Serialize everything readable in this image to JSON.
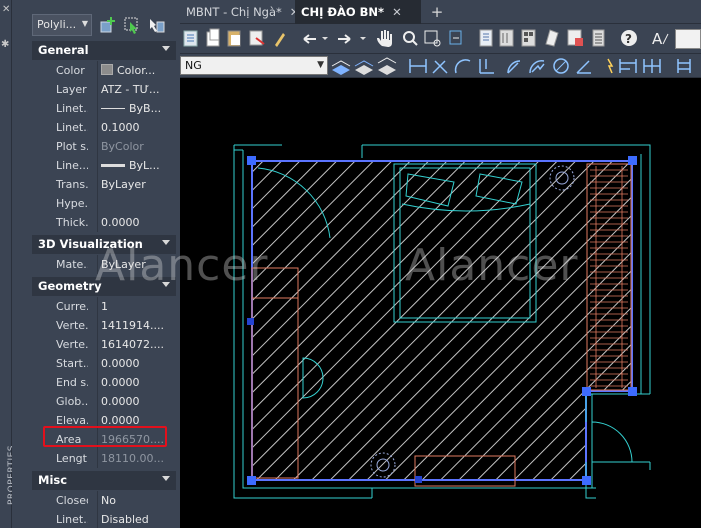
{
  "palette": {
    "object_type": "Polyli...",
    "vertical_title": "PROPERTIES",
    "sections": {
      "general": "General",
      "viz3d": "3D Visualization",
      "geometry": "Geometry",
      "misc": "Misc"
    },
    "general_rows": [
      {
        "label": "Color",
        "value": "Color..."
      },
      {
        "label": "Layer",
        "value": "ATZ - TƯ..."
      },
      {
        "label": "Linet...",
        "value": "ByB..."
      },
      {
        "label": "Linet...",
        "value": "0.1000"
      },
      {
        "label": "Plot s...",
        "value": "ByColor"
      },
      {
        "label": "Line...",
        "value": "ByL..."
      },
      {
        "label": "Trans...",
        "value": "ByLayer"
      },
      {
        "label": "Hype...",
        "value": ""
      },
      {
        "label": "Thick...",
        "value": "0.0000"
      }
    ],
    "viz3d_rows": [
      {
        "label": "Mate...",
        "value": "ByLayer"
      }
    ],
    "geometry_rows": [
      {
        "label": "Curre...",
        "value": "1"
      },
      {
        "label": "Verte...",
        "value": "1411914...."
      },
      {
        "label": "Verte...",
        "value": "1614072...."
      },
      {
        "label": "Start...",
        "value": "0.0000"
      },
      {
        "label": "End s...",
        "value": "0.0000"
      },
      {
        "label": "Glob...",
        "value": "0.0000"
      },
      {
        "label": "Eleva...",
        "value": "0.0000"
      },
      {
        "label": "Area",
        "value": "1966570...."
      },
      {
        "label": "Length",
        "value": "18110.00..."
      }
    ],
    "misc_rows": [
      {
        "label": "Closed",
        "value": "No"
      },
      {
        "label": "Linet...",
        "value": "Disabled"
      }
    ]
  },
  "tabs": [
    {
      "label": "MBNT - Chị Ngà*",
      "active": false
    },
    {
      "label": "CHỊ ĐÀO BN*",
      "active": true
    }
  ],
  "layer_combo": "NG",
  "watermark": "Alancer",
  "colors": {
    "panel_bg": "#3b4453",
    "section_bg": "#2f3642",
    "canvas_bg": "#000000",
    "hatch": "#bfbfbf",
    "selection": "#4a66ff",
    "wall": "#34d0d0",
    "furniture": "#e07a5f",
    "highlight": "#e3101c"
  }
}
